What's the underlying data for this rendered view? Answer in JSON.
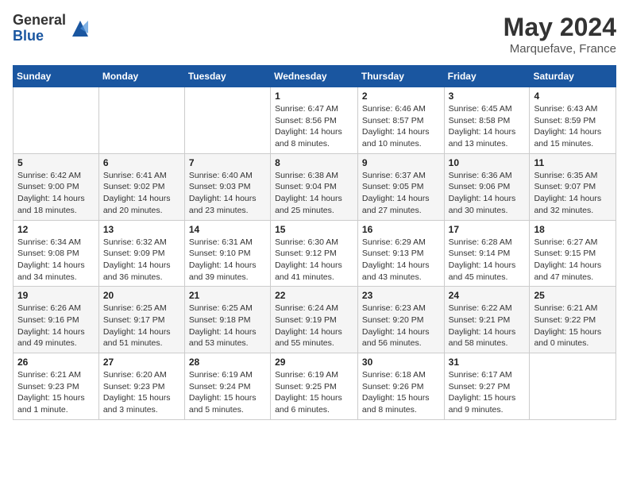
{
  "logo": {
    "general": "General",
    "blue": "Blue"
  },
  "title": "May 2024",
  "location": "Marquefave, France",
  "days_header": [
    "Sunday",
    "Monday",
    "Tuesday",
    "Wednesday",
    "Thursday",
    "Friday",
    "Saturday"
  ],
  "weeks": [
    [
      {
        "day": "",
        "info": ""
      },
      {
        "day": "",
        "info": ""
      },
      {
        "day": "",
        "info": ""
      },
      {
        "day": "1",
        "info": "Sunrise: 6:47 AM\nSunset: 8:56 PM\nDaylight: 14 hours\nand 8 minutes."
      },
      {
        "day": "2",
        "info": "Sunrise: 6:46 AM\nSunset: 8:57 PM\nDaylight: 14 hours\nand 10 minutes."
      },
      {
        "day": "3",
        "info": "Sunrise: 6:45 AM\nSunset: 8:58 PM\nDaylight: 14 hours\nand 13 minutes."
      },
      {
        "day": "4",
        "info": "Sunrise: 6:43 AM\nSunset: 8:59 PM\nDaylight: 14 hours\nand 15 minutes."
      }
    ],
    [
      {
        "day": "5",
        "info": "Sunrise: 6:42 AM\nSunset: 9:00 PM\nDaylight: 14 hours\nand 18 minutes."
      },
      {
        "day": "6",
        "info": "Sunrise: 6:41 AM\nSunset: 9:02 PM\nDaylight: 14 hours\nand 20 minutes."
      },
      {
        "day": "7",
        "info": "Sunrise: 6:40 AM\nSunset: 9:03 PM\nDaylight: 14 hours\nand 23 minutes."
      },
      {
        "day": "8",
        "info": "Sunrise: 6:38 AM\nSunset: 9:04 PM\nDaylight: 14 hours\nand 25 minutes."
      },
      {
        "day": "9",
        "info": "Sunrise: 6:37 AM\nSunset: 9:05 PM\nDaylight: 14 hours\nand 27 minutes."
      },
      {
        "day": "10",
        "info": "Sunrise: 6:36 AM\nSunset: 9:06 PM\nDaylight: 14 hours\nand 30 minutes."
      },
      {
        "day": "11",
        "info": "Sunrise: 6:35 AM\nSunset: 9:07 PM\nDaylight: 14 hours\nand 32 minutes."
      }
    ],
    [
      {
        "day": "12",
        "info": "Sunrise: 6:34 AM\nSunset: 9:08 PM\nDaylight: 14 hours\nand 34 minutes."
      },
      {
        "day": "13",
        "info": "Sunrise: 6:32 AM\nSunset: 9:09 PM\nDaylight: 14 hours\nand 36 minutes."
      },
      {
        "day": "14",
        "info": "Sunrise: 6:31 AM\nSunset: 9:10 PM\nDaylight: 14 hours\nand 39 minutes."
      },
      {
        "day": "15",
        "info": "Sunrise: 6:30 AM\nSunset: 9:12 PM\nDaylight: 14 hours\nand 41 minutes."
      },
      {
        "day": "16",
        "info": "Sunrise: 6:29 AM\nSunset: 9:13 PM\nDaylight: 14 hours\nand 43 minutes."
      },
      {
        "day": "17",
        "info": "Sunrise: 6:28 AM\nSunset: 9:14 PM\nDaylight: 14 hours\nand 45 minutes."
      },
      {
        "day": "18",
        "info": "Sunrise: 6:27 AM\nSunset: 9:15 PM\nDaylight: 14 hours\nand 47 minutes."
      }
    ],
    [
      {
        "day": "19",
        "info": "Sunrise: 6:26 AM\nSunset: 9:16 PM\nDaylight: 14 hours\nand 49 minutes."
      },
      {
        "day": "20",
        "info": "Sunrise: 6:25 AM\nSunset: 9:17 PM\nDaylight: 14 hours\nand 51 minutes."
      },
      {
        "day": "21",
        "info": "Sunrise: 6:25 AM\nSunset: 9:18 PM\nDaylight: 14 hours\nand 53 minutes."
      },
      {
        "day": "22",
        "info": "Sunrise: 6:24 AM\nSunset: 9:19 PM\nDaylight: 14 hours\nand 55 minutes."
      },
      {
        "day": "23",
        "info": "Sunrise: 6:23 AM\nSunset: 9:20 PM\nDaylight: 14 hours\nand 56 minutes."
      },
      {
        "day": "24",
        "info": "Sunrise: 6:22 AM\nSunset: 9:21 PM\nDaylight: 14 hours\nand 58 minutes."
      },
      {
        "day": "25",
        "info": "Sunrise: 6:21 AM\nSunset: 9:22 PM\nDaylight: 15 hours\nand 0 minutes."
      }
    ],
    [
      {
        "day": "26",
        "info": "Sunrise: 6:21 AM\nSunset: 9:23 PM\nDaylight: 15 hours\nand 1 minute."
      },
      {
        "day": "27",
        "info": "Sunrise: 6:20 AM\nSunset: 9:23 PM\nDaylight: 15 hours\nand 3 minutes."
      },
      {
        "day": "28",
        "info": "Sunrise: 6:19 AM\nSunset: 9:24 PM\nDaylight: 15 hours\nand 5 minutes."
      },
      {
        "day": "29",
        "info": "Sunrise: 6:19 AM\nSunset: 9:25 PM\nDaylight: 15 hours\nand 6 minutes."
      },
      {
        "day": "30",
        "info": "Sunrise: 6:18 AM\nSunset: 9:26 PM\nDaylight: 15 hours\nand 8 minutes."
      },
      {
        "day": "31",
        "info": "Sunrise: 6:17 AM\nSunset: 9:27 PM\nDaylight: 15 hours\nand 9 minutes."
      },
      {
        "day": "",
        "info": ""
      }
    ]
  ]
}
